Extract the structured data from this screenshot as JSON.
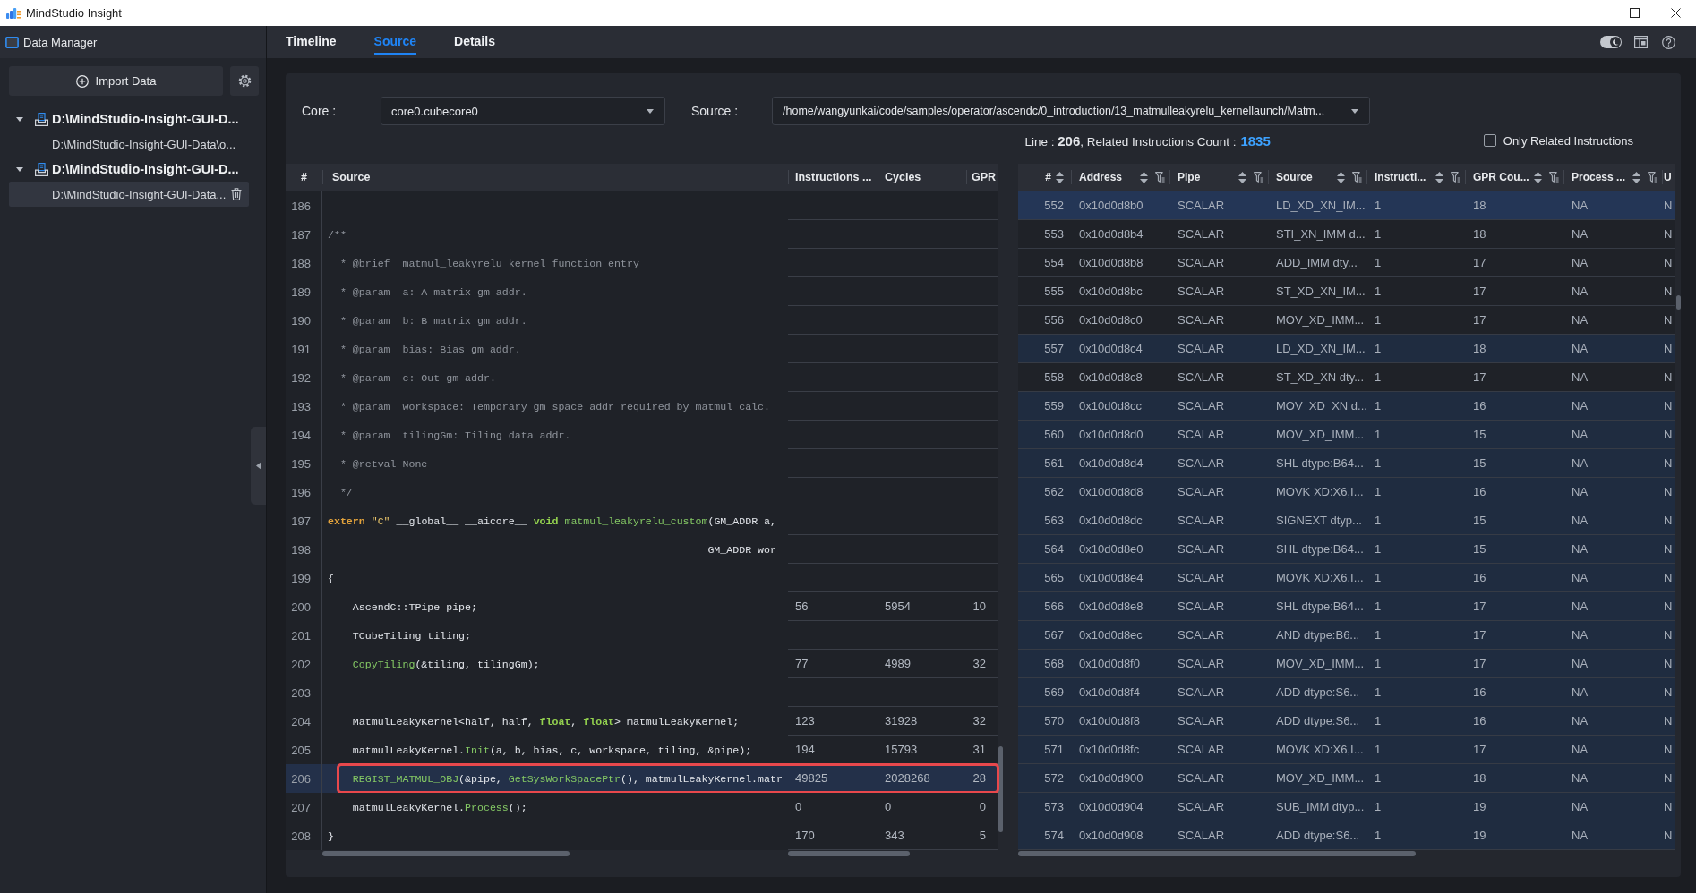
{
  "window": {
    "title": "MindStudio Insight"
  },
  "sidebar": {
    "title": "Data Manager",
    "import_label": "Import Data",
    "tree": [
      {
        "label": "D:\\MindStudio-Insight-GUI-D...",
        "expanded": true,
        "children": [
          {
            "label": "D:\\MindStudio-Insight-GUI-Data\\o...",
            "selected": false
          }
        ]
      },
      {
        "label": "D:\\MindStudio-Insight-GUI-D...",
        "expanded": true,
        "children": [
          {
            "label": "D:\\MindStudio-Insight-GUI-Data...",
            "selected": true
          }
        ]
      }
    ]
  },
  "tabs": [
    {
      "label": "Timeline",
      "selected": false
    },
    {
      "label": "Source",
      "selected": true
    },
    {
      "label": "Details",
      "selected": false
    }
  ],
  "toolbar": {
    "theme_switch": {
      "on": true
    }
  },
  "filters": {
    "core": {
      "label": "Core :",
      "value": "core0.cubecore0"
    },
    "source": {
      "label": "Source :",
      "value": "/home/wangyunkai/code/samples/operator/ascendc/0_introduction/13_matmulleakyrelu_kernellaunch/Matm..."
    }
  },
  "summary": {
    "text": "Line : **206**, Related Instructions Count :",
    "count": "1835"
  },
  "only_related": {
    "label": "Only Related Instructions",
    "checked": false
  },
  "source_table": {
    "columns": [
      "#",
      "Source",
      "Instructions ...",
      "Cycles",
      "GPR"
    ],
    "rows": [
      {
        "line": "186",
        "selected": false
      },
      {
        "line": "187",
        "selected": false,
        "code": [
          {
            "kind": "comment",
            "text": "/**"
          }
        ]
      },
      {
        "line": "188",
        "selected": false,
        "code": [
          {
            "kind": "comment",
            "text": "  * @brief  matmul_leakyrelu kernel function entry"
          }
        ]
      },
      {
        "line": "189",
        "selected": false,
        "code": [
          {
            "kind": "comment",
            "text": "  * @param  a: A matrix gm addr."
          }
        ]
      },
      {
        "line": "190",
        "selected": false,
        "code": [
          {
            "kind": "comment",
            "text": "  * @param  b: B matrix gm addr."
          }
        ]
      },
      {
        "line": "191",
        "selected": false,
        "code": [
          {
            "kind": "comment",
            "text": "  * @param  bias: Bias gm addr."
          }
        ]
      },
      {
        "line": "192",
        "selected": false,
        "code": [
          {
            "kind": "comment",
            "text": "  * @param  c: Out gm addr."
          }
        ]
      },
      {
        "line": "193",
        "selected": false,
        "code": [
          {
            "kind": "comment",
            "text": "  * @param  workspace: Temporary gm space addr required by matmul calc."
          }
        ]
      },
      {
        "line": "194",
        "selected": false,
        "code": [
          {
            "kind": "comment",
            "text": "  * @param  tilingGm: Tiling data addr."
          }
        ]
      },
      {
        "line": "195",
        "selected": false,
        "code": [
          {
            "kind": "comment",
            "text": "  * @retval None"
          }
        ]
      },
      {
        "line": "196",
        "selected": false,
        "code": [
          {
            "kind": "comment",
            "text": "  */"
          }
        ]
      },
      {
        "line": "197",
        "selected": false,
        "code": [
          {
            "kind": "keyword",
            "text": "extern"
          },
          {
            "kind": "string",
            "text": " \"C\""
          },
          {
            "kind": "plain",
            "text": " __global__ __aicore__ "
          },
          {
            "kind": "type",
            "text": "void"
          },
          {
            "kind": "function",
            "text": " matmul_leakyrelu_custom"
          },
          {
            "kind": "plain",
            "text": "(GM_ADDR a,"
          }
        ]
      },
      {
        "line": "198",
        "selected": false,
        "code": [
          {
            "kind": "plain",
            "text": "                                                             GM_ADDR wor"
          }
        ]
      },
      {
        "line": "199",
        "selected": false,
        "code": [
          {
            "kind": "plain",
            "text": "{"
          }
        ]
      },
      {
        "line": "200",
        "selected": false,
        "code": [
          {
            "kind": "plain",
            "text": "    AscendC::TPipe pipe;"
          }
        ],
        "stats": [
          "56",
          "5954",
          "10"
        ]
      },
      {
        "line": "201",
        "selected": false,
        "code": [
          {
            "kind": "plain",
            "text": "    TCubeTiling tiling;"
          }
        ]
      },
      {
        "line": "202",
        "selected": false,
        "code": [
          {
            "kind": "function",
            "text": "    CopyTiling"
          },
          {
            "kind": "plain",
            "text": "(&tiling, tilingGm);"
          }
        ],
        "stats": [
          "77",
          "4989",
          "32"
        ]
      },
      {
        "line": "203",
        "selected": false
      },
      {
        "line": "204",
        "selected": false,
        "code": [
          {
            "kind": "plain",
            "text": "    MatmulLeakyKernel<half, half, "
          },
          {
            "kind": "type",
            "text": "float"
          },
          {
            "kind": "plain",
            "text": ", "
          },
          {
            "kind": "type",
            "text": "float"
          },
          {
            "kind": "plain",
            "text": "> matmulLeakyKernel;"
          }
        ],
        "stats": [
          "123",
          "31928",
          "32"
        ]
      },
      {
        "line": "205",
        "selected": false,
        "code": [
          {
            "kind": "plain",
            "text": "    matmulLeakyKernel."
          },
          {
            "kind": "function",
            "text": "Init"
          },
          {
            "kind": "plain",
            "text": "(a, b, bias, c, workspace, tiling, &pipe);"
          }
        ],
        "stats": [
          "194",
          "15793",
          "31"
        ]
      },
      {
        "line": "206",
        "selected": true,
        "code": [
          {
            "kind": "function",
            "text": "    REGIST_MATMUL_OBJ"
          },
          {
            "kind": "plain",
            "text": "(&pipe, "
          },
          {
            "kind": "function",
            "text": "GetSysWorkSpacePtr"
          },
          {
            "kind": "plain",
            "text": "(), matmulLeakyKernel.matr"
          }
        ],
        "stats": [
          "49825",
          "2028268",
          "28"
        ]
      },
      {
        "line": "207",
        "selected": false,
        "code": [
          {
            "kind": "plain",
            "text": "    matmulLeakyKernel."
          },
          {
            "kind": "function",
            "text": "Process"
          },
          {
            "kind": "plain",
            "text": "();"
          }
        ],
        "stats": [
          "0",
          "0",
          "0"
        ]
      },
      {
        "line": "208",
        "selected": false,
        "code": [
          {
            "kind": "plain",
            "text": "}"
          }
        ],
        "stats": [
          "170",
          "343",
          "5"
        ]
      }
    ]
  },
  "instructions_table": {
    "columns": [
      {
        "label": "#",
        "sortable": true,
        "filterable": false
      },
      {
        "label": "Address",
        "sortable": true,
        "filterable": true
      },
      {
        "label": "Pipe",
        "sortable": true,
        "filterable": true
      },
      {
        "label": "Source",
        "sortable": true,
        "filterable": true
      },
      {
        "label": "Instructi...",
        "sortable": true,
        "filterable": true
      },
      {
        "label": "GPR Cou...",
        "sortable": true,
        "filterable": true
      },
      {
        "label": "Process ...",
        "sortable": true,
        "filterable": true
      },
      {
        "label": "U",
        "sortable": false,
        "filterable": false
      }
    ],
    "rows": [
      {
        "cells": [
          "552",
          "0x10d0d8b0",
          "SCALAR",
          "LD_XD_XN_IM...",
          "1",
          "18",
          "NA",
          "N"
        ],
        "selected": true,
        "highlighted": true
      },
      {
        "cells": [
          "553",
          "0x10d0d8b4",
          "SCALAR",
          "STI_XN_IMM d...",
          "1",
          "18",
          "NA",
          "N"
        ],
        "selected": false,
        "highlighted": false
      },
      {
        "cells": [
          "554",
          "0x10d0d8b8",
          "SCALAR",
          "ADD_IMM dty...",
          "1",
          "17",
          "NA",
          "N"
        ],
        "selected": false,
        "highlighted": false
      },
      {
        "cells": [
          "555",
          "0x10d0d8bc",
          "SCALAR",
          "ST_XD_XN_IM...",
          "1",
          "17",
          "NA",
          "N"
        ],
        "selected": false,
        "highlighted": false
      },
      {
        "cells": [
          "556",
          "0x10d0d8c0",
          "SCALAR",
          "MOV_XD_IMM...",
          "1",
          "17",
          "NA",
          "N"
        ],
        "selected": false,
        "highlighted": false
      },
      {
        "cells": [
          "557",
          "0x10d0d8c4",
          "SCALAR",
          "LD_XD_XN_IM...",
          "1",
          "18",
          "NA",
          "N"
        ],
        "selected": false,
        "highlighted": true
      },
      {
        "cells": [
          "558",
          "0x10d0d8c8",
          "SCALAR",
          "ST_XD_XN dty...",
          "1",
          "17",
          "NA",
          "N"
        ],
        "selected": false,
        "highlighted": false
      },
      {
        "cells": [
          "559",
          "0x10d0d8cc",
          "SCALAR",
          "MOV_XD_XN d...",
          "1",
          "16",
          "NA",
          "N"
        ],
        "selected": false,
        "highlighted": true
      },
      {
        "cells": [
          "560",
          "0x10d0d8d0",
          "SCALAR",
          "MOV_XD_IMM...",
          "1",
          "15",
          "NA",
          "N"
        ],
        "selected": false,
        "highlighted": true
      },
      {
        "cells": [
          "561",
          "0x10d0d8d4",
          "SCALAR",
          "SHL dtype:B64...",
          "1",
          "15",
          "NA",
          "N"
        ],
        "selected": false,
        "highlighted": true
      },
      {
        "cells": [
          "562",
          "0x10d0d8d8",
          "SCALAR",
          "MOVK XD:X6,I...",
          "1",
          "16",
          "NA",
          "N"
        ],
        "selected": false,
        "highlighted": true
      },
      {
        "cells": [
          "563",
          "0x10d0d8dc",
          "SCALAR",
          "SIGNEXT dtyp...",
          "1",
          "15",
          "NA",
          "N"
        ],
        "selected": false,
        "highlighted": true
      },
      {
        "cells": [
          "564",
          "0x10d0d8e0",
          "SCALAR",
          "SHL dtype:B64...",
          "1",
          "15",
          "NA",
          "N"
        ],
        "selected": false,
        "highlighted": true
      },
      {
        "cells": [
          "565",
          "0x10d0d8e4",
          "SCALAR",
          "MOVK XD:X6,I...",
          "1",
          "16",
          "NA",
          "N"
        ],
        "selected": false,
        "highlighted": true
      },
      {
        "cells": [
          "566",
          "0x10d0d8e8",
          "SCALAR",
          "SHL dtype:B64...",
          "1",
          "17",
          "NA",
          "N"
        ],
        "selected": false,
        "highlighted": true
      },
      {
        "cells": [
          "567",
          "0x10d0d8ec",
          "SCALAR",
          "AND dtype:B6...",
          "1",
          "17",
          "NA",
          "N"
        ],
        "selected": false,
        "highlighted": true
      },
      {
        "cells": [
          "568",
          "0x10d0d8f0",
          "SCALAR",
          "MOV_XD_IMM...",
          "1",
          "17",
          "NA",
          "N"
        ],
        "selected": false,
        "highlighted": true
      },
      {
        "cells": [
          "569",
          "0x10d0d8f4",
          "SCALAR",
          "ADD dtype:S6...",
          "1",
          "16",
          "NA",
          "N"
        ],
        "selected": false,
        "highlighted": true
      },
      {
        "cells": [
          "570",
          "0x10d0d8f8",
          "SCALAR",
          "ADD dtype:S6...",
          "1",
          "16",
          "NA",
          "N"
        ],
        "selected": false,
        "highlighted": true
      },
      {
        "cells": [
          "571",
          "0x10d0d8fc",
          "SCALAR",
          "MOVK XD:X6,I...",
          "1",
          "17",
          "NA",
          "N"
        ],
        "selected": false,
        "highlighted": true
      },
      {
        "cells": [
          "572",
          "0x10d0d900",
          "SCALAR",
          "MOV_XD_IMM...",
          "1",
          "18",
          "NA",
          "N"
        ],
        "selected": false,
        "highlighted": true
      },
      {
        "cells": [
          "573",
          "0x10d0d904",
          "SCALAR",
          "SUB_IMM dtyp...",
          "1",
          "19",
          "NA",
          "N"
        ],
        "selected": false,
        "highlighted": true
      },
      {
        "cells": [
          "574",
          "0x10d0d908",
          "SCALAR",
          "ADD dtype:S6...",
          "1",
          "19",
          "NA",
          "N"
        ],
        "selected": false,
        "highlighted": true
      }
    ]
  }
}
